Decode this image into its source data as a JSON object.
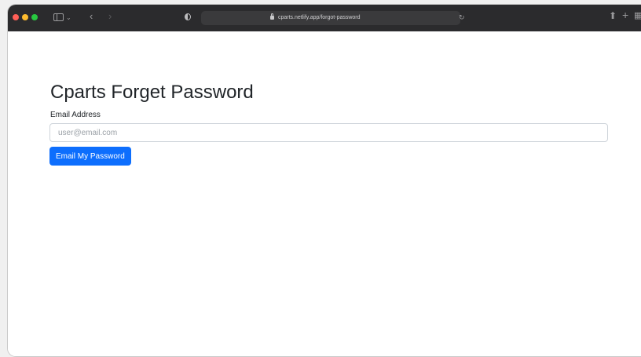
{
  "browser": {
    "url": "cparts.netlify.app/forgot-password",
    "icons": {
      "close": "close-window-icon",
      "minimize": "minimize-window-icon",
      "maximize": "maximize-window-icon",
      "sidebar": "sidebar-icon",
      "back": "back-arrow-icon",
      "forward": "forward-arrow-icon",
      "privacy": "shield-icon",
      "lock": "lock-icon",
      "reload": "reload-icon",
      "share": "share-icon",
      "new_tab": "plus-icon",
      "tab_overview": "tab-overview-icon"
    },
    "colors": {
      "close": "#ff5f57",
      "minimize": "#febc2e",
      "maximize": "#28c840",
      "toolbar": "#2b2b2d"
    }
  },
  "page": {
    "title": "Cparts Forget Password",
    "email_label": "Email Address",
    "email_placeholder": "user@email.com",
    "email_value": "",
    "submit_label": "Email My Password",
    "accent_color": "#0d6efd"
  }
}
